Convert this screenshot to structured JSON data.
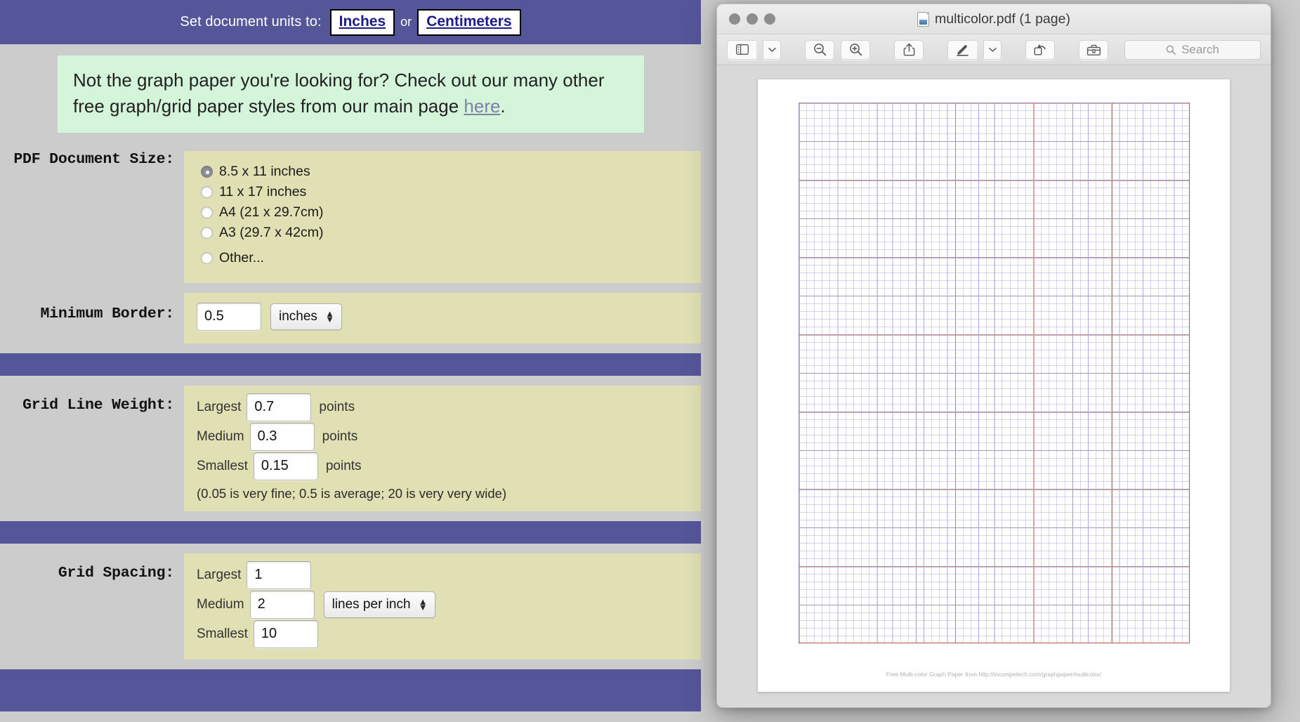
{
  "form": {
    "units_bar": {
      "label": "Set document units to:",
      "inches_label": "Inches",
      "or_label": "or",
      "centimeters_label": "Centimeters"
    },
    "notice": {
      "text_before": "Not the graph paper you're looking for? Check out our many other free graph/grid paper styles from our main page ",
      "link_label": "here",
      "text_after": "."
    },
    "doc_size": {
      "label": "PDF Document Size:",
      "options": [
        {
          "label": "8.5 x 11 inches",
          "checked": true
        },
        {
          "label": "11 x 17 inches",
          "checked": false
        },
        {
          "label": "A4 (21 x 29.7cm)",
          "checked": false
        },
        {
          "label": "A3 (29.7 x 42cm)",
          "checked": false
        },
        {
          "label": "Other...",
          "checked": false
        }
      ]
    },
    "minimum_border": {
      "label": "Minimum Border:",
      "value": "0.5",
      "unit_selected": "inches"
    },
    "grid_line_weight": {
      "label": "Grid Line Weight:",
      "rows": [
        {
          "name": "Largest",
          "value": "0.7",
          "unit": "points"
        },
        {
          "name": "Medium",
          "value": "0.3",
          "unit": "points"
        },
        {
          "name": "Smallest",
          "value": "0.15",
          "unit": "points"
        }
      ],
      "note": "(0.05 is very fine; 0.5 is average; 20 is very very wide)"
    },
    "grid_spacing": {
      "label": "Grid Spacing:",
      "rows": [
        {
          "name": "Largest",
          "value": "1"
        },
        {
          "name": "Medium",
          "value": "2"
        },
        {
          "name": "Smallest",
          "value": "10"
        }
      ],
      "unit_selected": "lines per inch"
    },
    "colors": {
      "purple": "#55559a",
      "field_tan": "#e0e0b4",
      "page_grey": "#cccccc",
      "notice_green": "#d4f5d9"
    }
  },
  "preview_window": {
    "title": "multicolor.pdf (1 page)",
    "doc_icon": "pdf-document-icon",
    "traffic_lights": [
      "close-button",
      "minimize-button",
      "zoom-button"
    ],
    "toolbar": {
      "sidebar_icon": "sidebar-toggle-icon",
      "sidebar_chevron_icon": "chevron-down-icon",
      "zoom_out_icon": "zoom-out-icon",
      "zoom_in_icon": "zoom-in-icon",
      "share_icon": "share-icon",
      "markup_icon": "markup-pen-icon",
      "markup_chevron_icon": "chevron-down-icon",
      "rotate_icon": "rotate-left-icon",
      "toolbox_icon": "toolbox-icon",
      "search_icon": "search-icon",
      "search_placeholder": "Search"
    },
    "document": {
      "caption": "Free Multi-color Graph Paper from http://incompetech.com/graphpaper/multicolor/",
      "grid_colors": {
        "largest": "#c0504d",
        "medium": "#8c8c8c",
        "smallest": "#a9a9e8"
      }
    }
  }
}
